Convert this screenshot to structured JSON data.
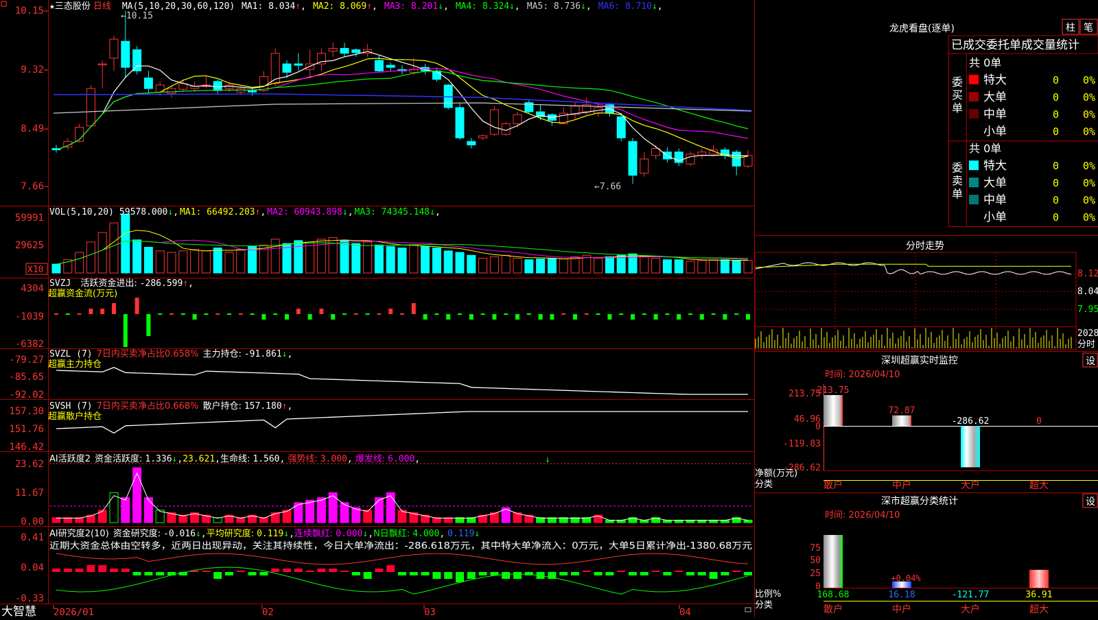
{
  "stock": {
    "marker": "★",
    "name": "三态股份",
    "period": "日线",
    "ma_header": "MA(5,10,20,30,60,120)",
    "ma_values": [
      {
        "label": "MA1:",
        "value": "8.034",
        "arrow": "↑",
        "color": "#ffffff"
      },
      {
        "label": "MA2:",
        "value": "8.069",
        "arrow": "↑",
        "color": "#ffff00"
      },
      {
        "label": "MA3:",
        "value": "8.201",
        "arrow": "↓",
        "color": "#ff00ff"
      },
      {
        "label": "MA4:",
        "value": "8.324",
        "arrow": "↓",
        "color": "#00ff00"
      },
      {
        "label": "MA5:",
        "value": "8.736",
        "arrow": "↓",
        "color": "#cccccc"
      },
      {
        "label": "MA6:",
        "value": "8.710",
        "arrow": "↓",
        "color": "#3333ff"
      }
    ],
    "high_label": "10.15",
    "low_label": "7.66",
    "price_axis": [
      "10.15",
      "9.32",
      "8.49",
      "7.66"
    ]
  },
  "volume": {
    "header": "VOL(5,10,20)",
    "value": "59578.000",
    "value_arrow": "↓",
    "ma": [
      {
        "label": "MA1:",
        "value": "66492.203",
        "arrow": "↑",
        "color": "#ffff00"
      },
      {
        "label": "MA2:",
        "value": "60943.898",
        "arrow": "↓",
        "color": "#ff00ff"
      },
      {
        "label": "MA3:",
        "value": "74345.148",
        "arrow": "↓",
        "color": "#00ff00"
      }
    ],
    "axis": [
      "59991",
      "29625"
    ],
    "unit": "X10"
  },
  "svzj": {
    "header": "SVZJ",
    "label": "活跃资金进出:",
    "value": "-286.599",
    "arrow": "↑",
    "title": "超赢资金流(万元)",
    "axis": [
      "4304",
      "-1039",
      "-6382"
    ]
  },
  "svzl": {
    "header": "SVZL  (7)",
    "ratio_label": "7日内买卖净占比0.658%",
    "hold_label": "主力持仓:",
    "hold_value": "-91.861",
    "arrow": "↓",
    "title": "超赢主力持仓",
    "axis": [
      "-79.27",
      "-85.65",
      "-92.02"
    ]
  },
  "svsh": {
    "header": "SVSH  (7)",
    "ratio_label": "7日内买卖净占比0.668%",
    "hold_label": "散户持仓:",
    "hold_value": "157.180",
    "arrow": "↑",
    "title": "超赢散户持仓",
    "axis": [
      "157.30",
      "151.76",
      "146.42"
    ]
  },
  "ai_active": {
    "header": "AI活跃度2",
    "label": "资金活跃度:",
    "value": "1.336",
    "value_arrow": "↓",
    "value2": "23.621",
    "life_label": "生命线:",
    "life_value": "1.560",
    "strong_label": "强势线:",
    "strong_value": "3.000",
    "burst_label": "爆发线:",
    "burst_value": "6.000",
    "axis": [
      "23.62",
      "11.67",
      "0.00"
    ]
  },
  "ai_research": {
    "header": "AI研究度2(10)",
    "label": "资金研究度:",
    "value": "-0.016",
    "value_arrow": "↓",
    "avg_label": "平均研究度:",
    "avg_value": "0.119",
    "avg_arrow": "↓",
    "red_label": "连续飘红:",
    "red_value": "0.000",
    "red_arrow": "↓",
    "n_label": "N日飘红:",
    "n_value": "4.000",
    "last_value": "0.119",
    "comment": "近期大资金总体由空转多，近两日出现异动，关注其持续性，今日大单净流出：-286.618万元，其中特大单净流入：0万元，大单5日累计净出-1380.68万元",
    "axis": [
      "0.41",
      "0.04",
      "-0.33"
    ]
  },
  "footer": {
    "app_name": "大智慧",
    "dates": [
      "2026/01",
      "02",
      "03",
      "04"
    ]
  },
  "right": {
    "lhb_title": "龙虎看盘(逐单)",
    "tab_bar": "柱",
    "tab_pen": "笔",
    "stats_title": "已成交委托单成交量统计",
    "buy_label": "委买单",
    "sell_label": "委卖单",
    "buy_total": "共 0单",
    "sell_total": "共 0单",
    "buy_rows": [
      {
        "name": "特大",
        "count": "0",
        "pct": "0%",
        "color": "#ff0000"
      },
      {
        "name": "大单",
        "count": "0",
        "pct": "0%",
        "color": "#990000"
      },
      {
        "name": "中单",
        "count": "0",
        "pct": "0%",
        "color": "#660000"
      },
      {
        "name": "小单",
        "count": "0",
        "pct": "0%",
        "color": ""
      }
    ],
    "sell_rows": [
      {
        "name": "特大",
        "count": "0",
        "pct": "0%",
        "color": "#00ffff"
      },
      {
        "name": "大单",
        "count": "0",
        "pct": "0%",
        "color": "#008888"
      },
      {
        "name": "中单",
        "count": "0",
        "pct": "0%",
        "color": "#007777"
      },
      {
        "name": "小单",
        "count": "0",
        "pct": "0%",
        "color": ""
      }
    ],
    "intraday_title": "分时走势",
    "intraday_axis": [
      "8.12",
      "8.04",
      "7.95"
    ],
    "intraday_vol": "2028",
    "intraday_vol_unit": "分时",
    "monitor_title": "深圳超赢实时监控",
    "monitor_time": "时间: 2026/04/10",
    "monitor_axis": [
      "213.75",
      "46.96",
      "0",
      "-119.83",
      "-286.62"
    ],
    "monitor_bars": [
      {
        "label": "213.75",
        "value": 213.75,
        "cat": "散户"
      },
      {
        "label": "72.87",
        "value": 72.87,
        "cat": "中户"
      },
      {
        "label": "-286.62",
        "value": -286.62,
        "cat": "大户"
      },
      {
        "label": "0",
        "value": 0,
        "cat": "超大"
      }
    ],
    "monitor_ylabel": "净额(万元)",
    "class_label": "分类",
    "set_button": "设",
    "class_title": "深市超赢分类统计",
    "class_time": "时间: 2026/04/10",
    "class_axis": [
      "75",
      "50",
      "25",
      "0"
    ],
    "class_bars": [
      {
        "label": "168.68",
        "pct": 100,
        "cat": "散户"
      },
      {
        "label": "16.18",
        "pct": 12,
        "cat": "中户",
        "note": "+0.04%"
      },
      {
        "label": "-121.77",
        "pct": 0,
        "cat": "大户"
      },
      {
        "label": "36.91",
        "pct": 34,
        "cat": "超大"
      }
    ],
    "class_ylabel": "比例%"
  }
}
